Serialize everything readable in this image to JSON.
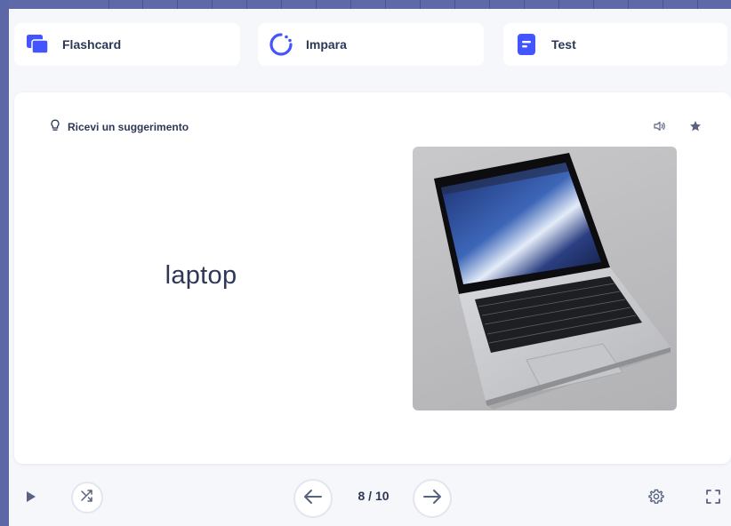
{
  "modes": [
    {
      "label": "Flashcard",
      "icon": "flashcards-icon"
    },
    {
      "label": "Impara",
      "icon": "learn-icon"
    },
    {
      "label": "Test",
      "icon": "test-icon"
    }
  ],
  "card": {
    "hint_label": "Ricevi un suggerimento",
    "term": "laptop",
    "image": "laptop-photo"
  },
  "navigation": {
    "counter": "8 / 10",
    "current": 8,
    "total": 10
  },
  "colors": {
    "accent": "#4255ff",
    "frame": "#5b67a6",
    "text": "#2e3856",
    "background": "#f6f7fb"
  }
}
